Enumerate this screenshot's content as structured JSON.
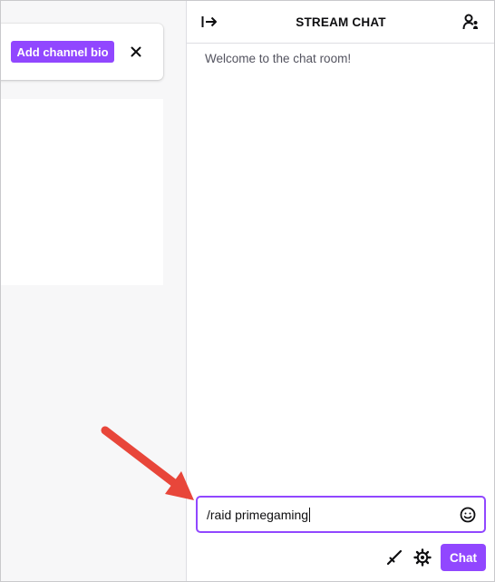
{
  "channel": {
    "bio_button_label": "Add channel bio",
    "close_icon": "close-icon"
  },
  "chat": {
    "title": "STREAM CHAT",
    "collapse_icon": "collapse-right-icon",
    "users_icon": "community-users-icon",
    "welcome_message": "Welcome to the chat room!",
    "input_value": "/raid primegaming",
    "emote_icon": "smiley-icon",
    "bits_icon": "sword-icon",
    "settings_icon": "gear-icon",
    "send_label": "Chat"
  },
  "colors": {
    "accent": "#9147ff",
    "annotation_arrow": "#e8463a"
  }
}
